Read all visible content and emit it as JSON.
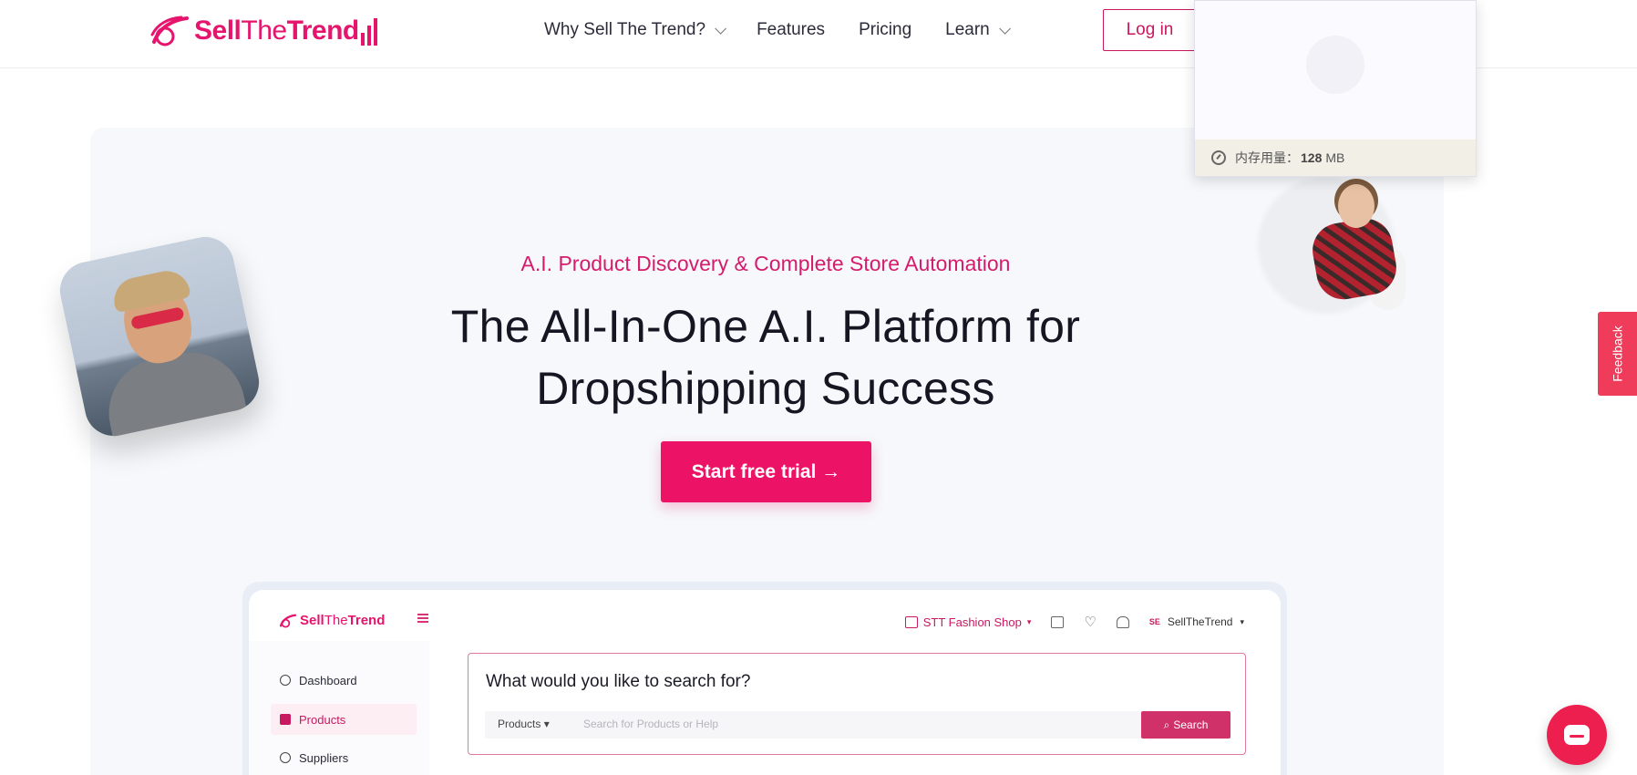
{
  "brand": {
    "logo_text_bold": "Sell",
    "logo_text_thin": "The",
    "logo_text_end": "Trend",
    "accent": "#e5146d"
  },
  "nav": {
    "items": [
      {
        "label": "Why Sell The Trend?",
        "has_dropdown": true
      },
      {
        "label": "Features",
        "has_dropdown": false
      },
      {
        "label": "Pricing",
        "has_dropdown": false
      },
      {
        "label": "Learn",
        "has_dropdown": true
      }
    ],
    "login_label": "Log in"
  },
  "memory_popup": {
    "label": "内存用量：",
    "value": "128",
    "unit": "MB"
  },
  "hero": {
    "kicker": "A.I. Product Discovery & Complete Store Automation",
    "headline_line1": "The All-In-One A.I. Platform for",
    "headline_line2": "Dropshipping Success",
    "cta_label": "Start free trial →",
    "cta_color": "#ec1266"
  },
  "feedback_label": "Feedback",
  "preview": {
    "logo_bold": "Sell",
    "logo_thin": "The",
    "logo_end": "Trend",
    "shop_label": "STT Fashion Shop",
    "user_initials": "SE",
    "user_name": "SellTheTrend",
    "sidebar": [
      {
        "label": "Dashboard",
        "active": false
      },
      {
        "label": "Products",
        "active": true
      },
      {
        "label": "Suppliers",
        "active": false
      }
    ],
    "search": {
      "question": "What would you like to search for?",
      "category": "Products",
      "placeholder": "Search for Products or Help",
      "button_label": "Search"
    }
  }
}
